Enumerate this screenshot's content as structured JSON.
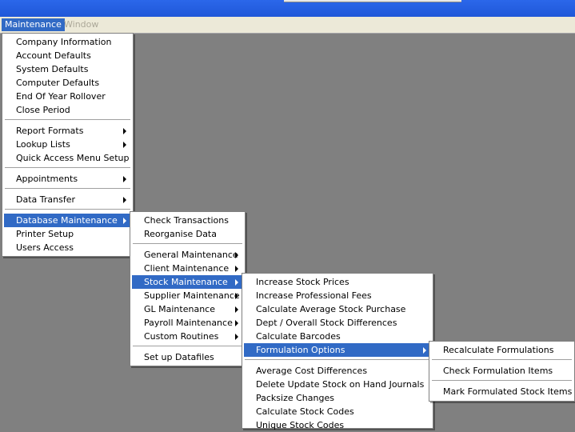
{
  "menubar": {
    "maintenance": "Maintenance",
    "window": "Window"
  },
  "main_menu": {
    "company_information": "Company Information",
    "account_defaults": "Account Defaults",
    "system_defaults": "System Defaults",
    "computer_defaults": "Computer Defaults",
    "end_of_year_rollover": "End Of Year Rollover",
    "close_period": "Close Period",
    "report_formats": "Report Formats",
    "lookup_lists": "Lookup Lists",
    "quick_access_menu_setup": "Quick Access Menu Setup",
    "appointments": "Appointments",
    "data_transfer": "Data Transfer",
    "database_maintenance": "Database Maintenance",
    "printer_setup": "Printer Setup",
    "users_access": "Users Access"
  },
  "db_menu": {
    "check_transactions": "Check Transactions",
    "reorganise_data": "Reorganise Data",
    "general_maintenance": "General Maintenance",
    "client_maintenance": "Client Maintenance",
    "stock_maintenance": "Stock Maintenance",
    "supplier_maintenance": "Supplier Maintenance",
    "gl_maintenance": "GL Maintenance",
    "payroll_maintenance": "Payroll Maintenance",
    "custom_routines": "Custom Routines",
    "set_up_datafiles": "Set up Datafiles"
  },
  "stock_menu": {
    "increase_stock_prices": "Increase Stock Prices",
    "increase_professional_fees": "Increase Professional Fees",
    "calculate_average_stock_purchase": "Calculate Average Stock Purchase",
    "dept_overall_stock_differences": "Dept / Overall Stock Differences",
    "calculate_barcodes": "Calculate Barcodes",
    "formulation_options": "Formulation Options",
    "average_cost_differences": "Average Cost Differences",
    "delete_update_stock_on_hand_journals": "Delete Update Stock on Hand Journals",
    "packsize_changes": "Packsize Changes",
    "calculate_stock_codes": "Calculate Stock Codes",
    "unique_stock_codes": "Unique Stock Codes"
  },
  "formulation_menu": {
    "recalculate_formulations": "Recalculate Formulations",
    "check_formulation_items": "Check Formulation Items",
    "mark_formulated_stock_items": "Mark Formulated Stock Items"
  },
  "colors": {
    "highlight": "#316ac5",
    "desktop": "#808080",
    "menubar": "#ece9d8",
    "titlebar": "#1f57d8"
  }
}
